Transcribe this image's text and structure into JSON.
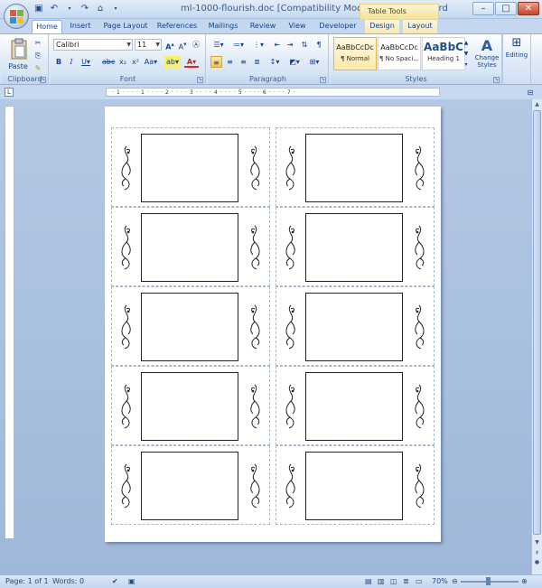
{
  "window": {
    "title": "ml-1000-flourish.doc [Compatibility Mode] - Microsoft Word",
    "context_tab_group": "Table Tools"
  },
  "tabs": [
    {
      "label": "Home",
      "active": true
    },
    {
      "label": "Insert"
    },
    {
      "label": "Page Layout"
    },
    {
      "label": "References"
    },
    {
      "label": "Mailings"
    },
    {
      "label": "Review"
    },
    {
      "label": "View"
    },
    {
      "label": "Developer"
    },
    {
      "label": "Design",
      "context": true
    },
    {
      "label": "Layout",
      "context": true
    }
  ],
  "ribbon": {
    "clipboard": {
      "label": "Clipboard",
      "paste": "Paste"
    },
    "font": {
      "label": "Font",
      "family": "Calibri",
      "size": "11"
    },
    "paragraph": {
      "label": "Paragraph"
    },
    "styles": {
      "label": "Styles",
      "items": [
        {
          "sample": "AaBbCcDc",
          "name": "¶ Normal",
          "selected": true
        },
        {
          "sample": "AaBbCcDc",
          "name": "¶ No Spaci..."
        },
        {
          "sample": "AaBbC",
          "name": "Heading 1"
        }
      ],
      "change_styles": "Change Styles"
    },
    "editing": {
      "label": "Editing"
    }
  },
  "ruler": {
    "corner_symbol": "L",
    "ticks": "· 1 · · · · 1 · · · · 2 · · · · 3 · · · · 4 · · · · 5 · · · · 6 · · · · 7 ·"
  },
  "document": {
    "columns": 2,
    "rows": 5
  },
  "statusbar": {
    "page": "Page: 1 of 1",
    "words": "Words: 0",
    "zoom": "70%",
    "zoom_level": 0.7
  },
  "colors": {
    "accent": "#15428b",
    "workspace": "#a9bfdf",
    "context_tab": "#f3e39a"
  }
}
